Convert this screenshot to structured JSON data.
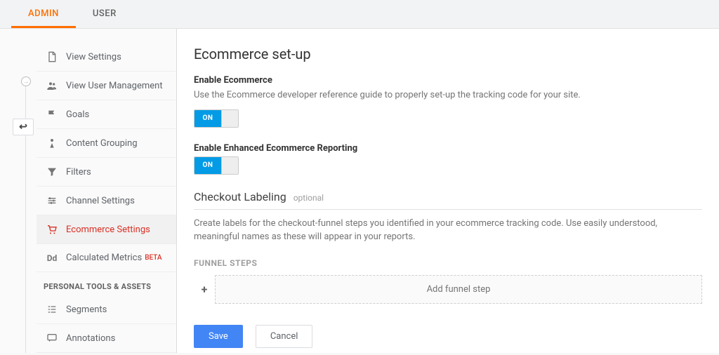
{
  "tabs": {
    "admin": "ADMIN",
    "user": "USER"
  },
  "back_char": "↩",
  "sidebar": {
    "items": [
      {
        "label": "View Settings",
        "icon": "document-icon"
      },
      {
        "label": "View User Management",
        "icon": "people-icon"
      },
      {
        "label": "Goals",
        "icon": "flag-icon"
      },
      {
        "label": "Content Grouping",
        "icon": "person-flag-icon"
      },
      {
        "label": "Filters",
        "icon": "funnel-icon"
      },
      {
        "label": "Channel Settings",
        "icon": "sliders-icon"
      },
      {
        "label": "Ecommerce Settings",
        "icon": "cart-icon"
      },
      {
        "label": "Calculated Metrics",
        "icon": "dd-icon",
        "badge": "BETA"
      }
    ],
    "section_header": "PERSONAL TOOLS & ASSETS",
    "tools": [
      {
        "label": "Segments",
        "icon": "segments-icon"
      },
      {
        "label": "Annotations",
        "icon": "annotation-icon"
      }
    ]
  },
  "main": {
    "title": "Ecommerce set-up",
    "enable_ecom_label": "Enable Ecommerce",
    "enable_ecom_help": "Use the Ecommerce developer reference guide to properly set-up the tracking code for your site.",
    "toggle_on": "ON",
    "enable_enhanced_label": "Enable Enhanced Ecommerce Reporting",
    "checkout_section": "Checkout Labeling",
    "optional": "optional",
    "checkout_help": "Create labels for the checkout-funnel steps you identified in your ecommerce tracking code. Use easily understood, meaningful names as these will appear in your reports.",
    "funnel_header": "FUNNEL STEPS",
    "add_step": "Add funnel step",
    "plus": "+",
    "save": "Save",
    "cancel": "Cancel"
  }
}
